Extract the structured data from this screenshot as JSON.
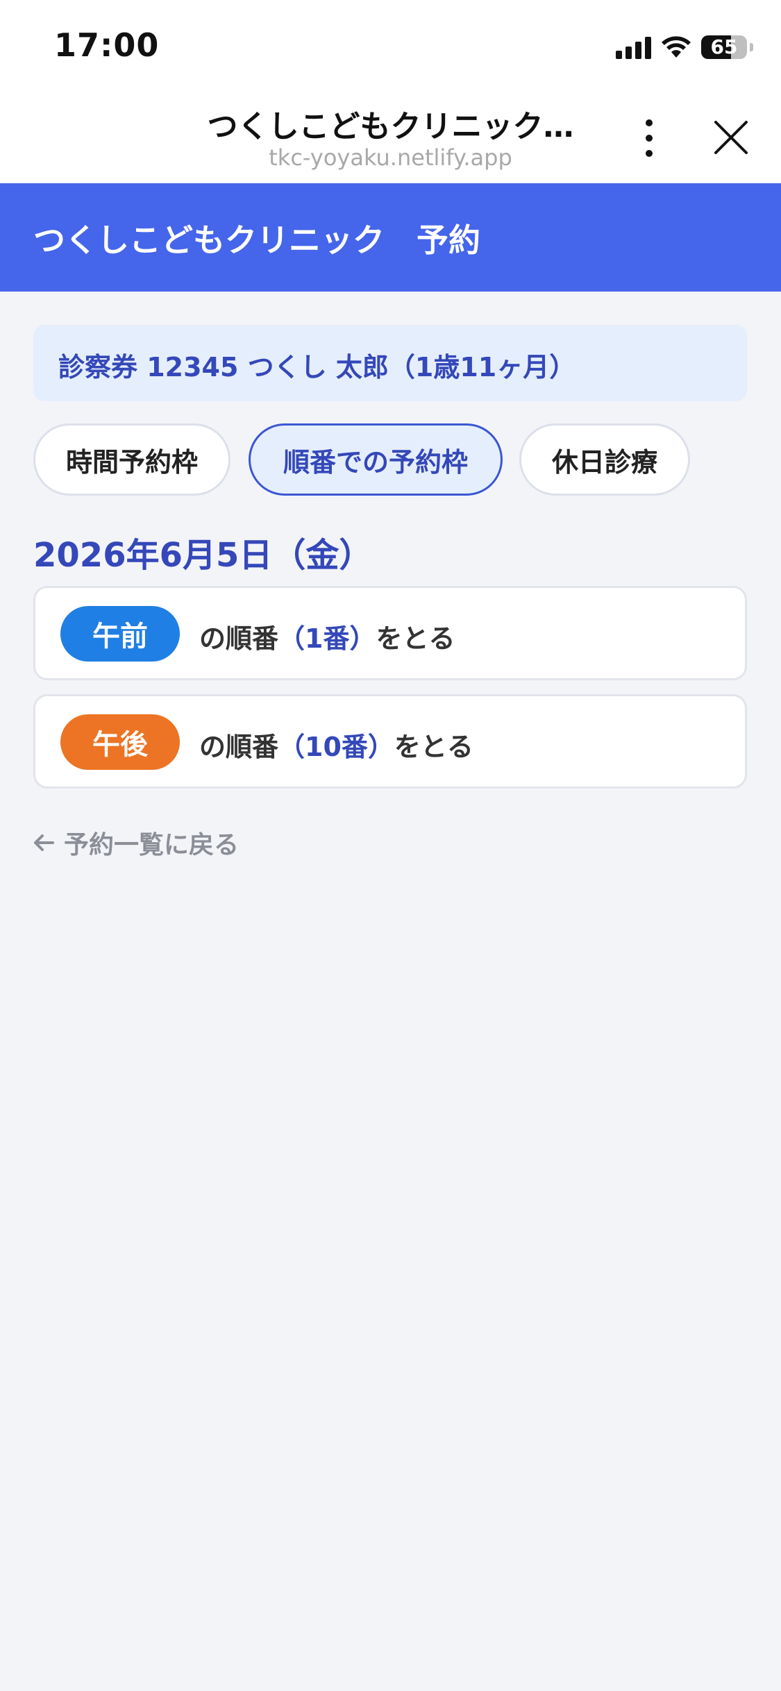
{
  "status_bar": {
    "time": "17:00",
    "battery": "65",
    "battery_level": 0.65,
    "icons": [
      "signal-icon",
      "wifi-icon",
      "battery-icon"
    ]
  },
  "browser": {
    "title": "つくしこどもクリニック…",
    "url": "tkc-yoyaku.netlify.app",
    "icons": [
      "more-vertical-icon",
      "close-icon"
    ]
  },
  "app_header": {
    "title": "つくしこどもクリニック　予約",
    "color": "#4565ea"
  },
  "patient": {
    "label": "診察券 12345 つくし 太郎（1歳11ヶ月）"
  },
  "tabs": [
    {
      "label": "時間予約枠",
      "active": false
    },
    {
      "label": "順番での予約枠",
      "active": true
    },
    {
      "label": "休日診療",
      "active": false
    }
  ],
  "date_heading": "2026年6月5日（金）",
  "slots": [
    {
      "badge": "午前",
      "badge_color": "#1f7fe4",
      "prefix": "の順番",
      "number": "（1番）",
      "suffix": "をとる"
    },
    {
      "badge": "午後",
      "badge_color": "#ec7424",
      "prefix": "の順番",
      "number": "（10番）",
      "suffix": "をとる"
    }
  ],
  "back_link": {
    "icon": "arrow-left-icon",
    "label": "予約一覧に戻る"
  }
}
